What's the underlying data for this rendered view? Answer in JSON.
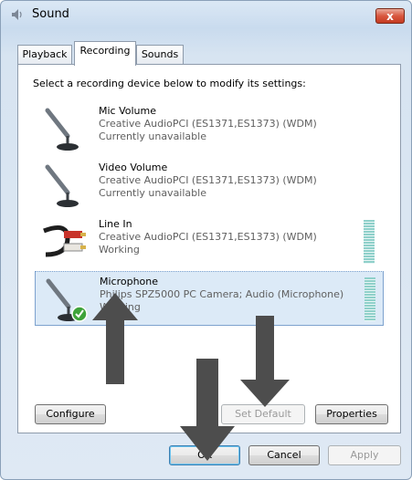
{
  "window": {
    "title": "Sound",
    "close_label": "x"
  },
  "tabs": [
    {
      "label": "Playback",
      "active": false
    },
    {
      "label": "Recording",
      "active": true
    },
    {
      "label": "Sounds",
      "active": false
    }
  ],
  "instruction": "Select a recording device below to modify its settings:",
  "devices": [
    {
      "name": "Mic Volume",
      "detail": "Creative AudioPCI (ES1371,ES1373) (WDM)",
      "status": "Currently unavailable",
      "icon": "microphone-icon",
      "selected": false
    },
    {
      "name": "Video Volume",
      "detail": "Creative AudioPCI (ES1371,ES1373) (WDM)",
      "status": "Currently unavailable",
      "icon": "microphone-icon",
      "selected": false
    },
    {
      "name": "Line In",
      "detail": "Creative AudioPCI (ES1371,ES1373) (WDM)",
      "status": "Working",
      "icon": "rca-cable-icon",
      "selected": false
    },
    {
      "name": "Microphone",
      "detail": "Philips SPZ5000 PC Camera; Audio (Microphone)",
      "status": "Working",
      "icon": "microphone-default-icon",
      "selected": true
    }
  ],
  "buttons": {
    "configure": "Configure",
    "set_default": "Set Default",
    "properties": "Properties",
    "ok": "OK",
    "cancel": "Cancel",
    "apply": "Apply"
  },
  "colors": {
    "selection": "#dceaf7",
    "arrow": "#4d4d4d",
    "close": "#c43b21"
  }
}
